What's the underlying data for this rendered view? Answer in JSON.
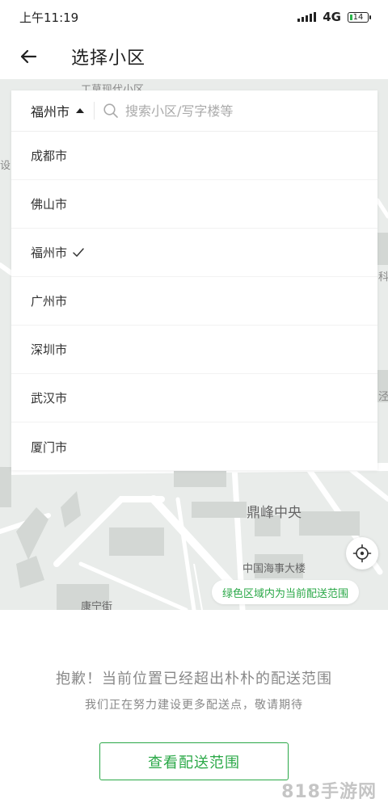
{
  "status": {
    "time": "上午11:19",
    "network": "4G",
    "battery": "14"
  },
  "header": {
    "title": "选择小区"
  },
  "search": {
    "city": "福州市",
    "placeholder": "搜索小区/写字楼等"
  },
  "city_list": {
    "items": [
      {
        "label": "成都市",
        "selected": false
      },
      {
        "label": "佛山市",
        "selected": false
      },
      {
        "label": "福州市",
        "selected": true
      },
      {
        "label": "广州市",
        "selected": false
      },
      {
        "label": "深圳市",
        "selected": false
      },
      {
        "label": "武汉市",
        "selected": false
      },
      {
        "label": "厦门市",
        "selected": false
      }
    ]
  },
  "map": {
    "labels": {
      "top_cut": "工莫现代小区",
      "left_cut": "设",
      "right_cut_1": "科",
      "right_cut_2": "泾",
      "dingfeng": "鼎峰中央",
      "building": "中国海事大楼",
      "street": "康宁街"
    },
    "range_tip": "绿色区域内为当前配送范围"
  },
  "notice": {
    "main": "抱歉！当前位置已经超出朴朴的配送范围",
    "sub": "我们正在努力建设更多配送点，敬请期待"
  },
  "action": {
    "view_range": "查看配送范围"
  },
  "watermark": "818手游网",
  "icons": {
    "back": "arrow-left-icon",
    "search": "search-icon",
    "check": "check-icon",
    "locate": "locate-crosshair-icon"
  },
  "colors": {
    "accent": "#2aa847",
    "map_bg": "#e9ecea",
    "text_muted": "#888888"
  }
}
